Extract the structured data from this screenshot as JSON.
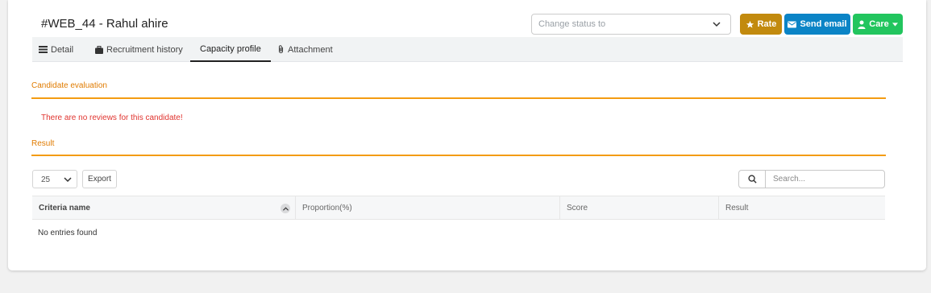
{
  "header": {
    "title": "#WEB_44 - Rahul ahire",
    "status_placeholder": "Change status to",
    "buttons": {
      "rate": "Rate",
      "send_email": "Send email",
      "care": "Care"
    }
  },
  "tabs": [
    {
      "label": "Detail",
      "icon": "list-icon",
      "active": false
    },
    {
      "label": "Recruitment history",
      "icon": "briefcase-icon",
      "active": false
    },
    {
      "label": "Capacity profile",
      "icon": "",
      "active": true
    },
    {
      "label": "Attachment",
      "icon": "paperclip-icon",
      "active": false
    }
  ],
  "evaluation": {
    "title": "Candidate evaluation",
    "empty_message": "There are no reviews for this candidate!"
  },
  "result": {
    "title": "Result",
    "page_length": "25",
    "export_label": "Export",
    "search_placeholder": "Search...",
    "columns": [
      "Criteria name",
      "Proportion(%)",
      "Score",
      "Result"
    ],
    "empty_message": "No entries found"
  },
  "colors": {
    "accent": "#f39c12",
    "rate": "#c28a0e",
    "email": "#0b84c6",
    "care": "#22c55e",
    "error": "#e0342f"
  }
}
